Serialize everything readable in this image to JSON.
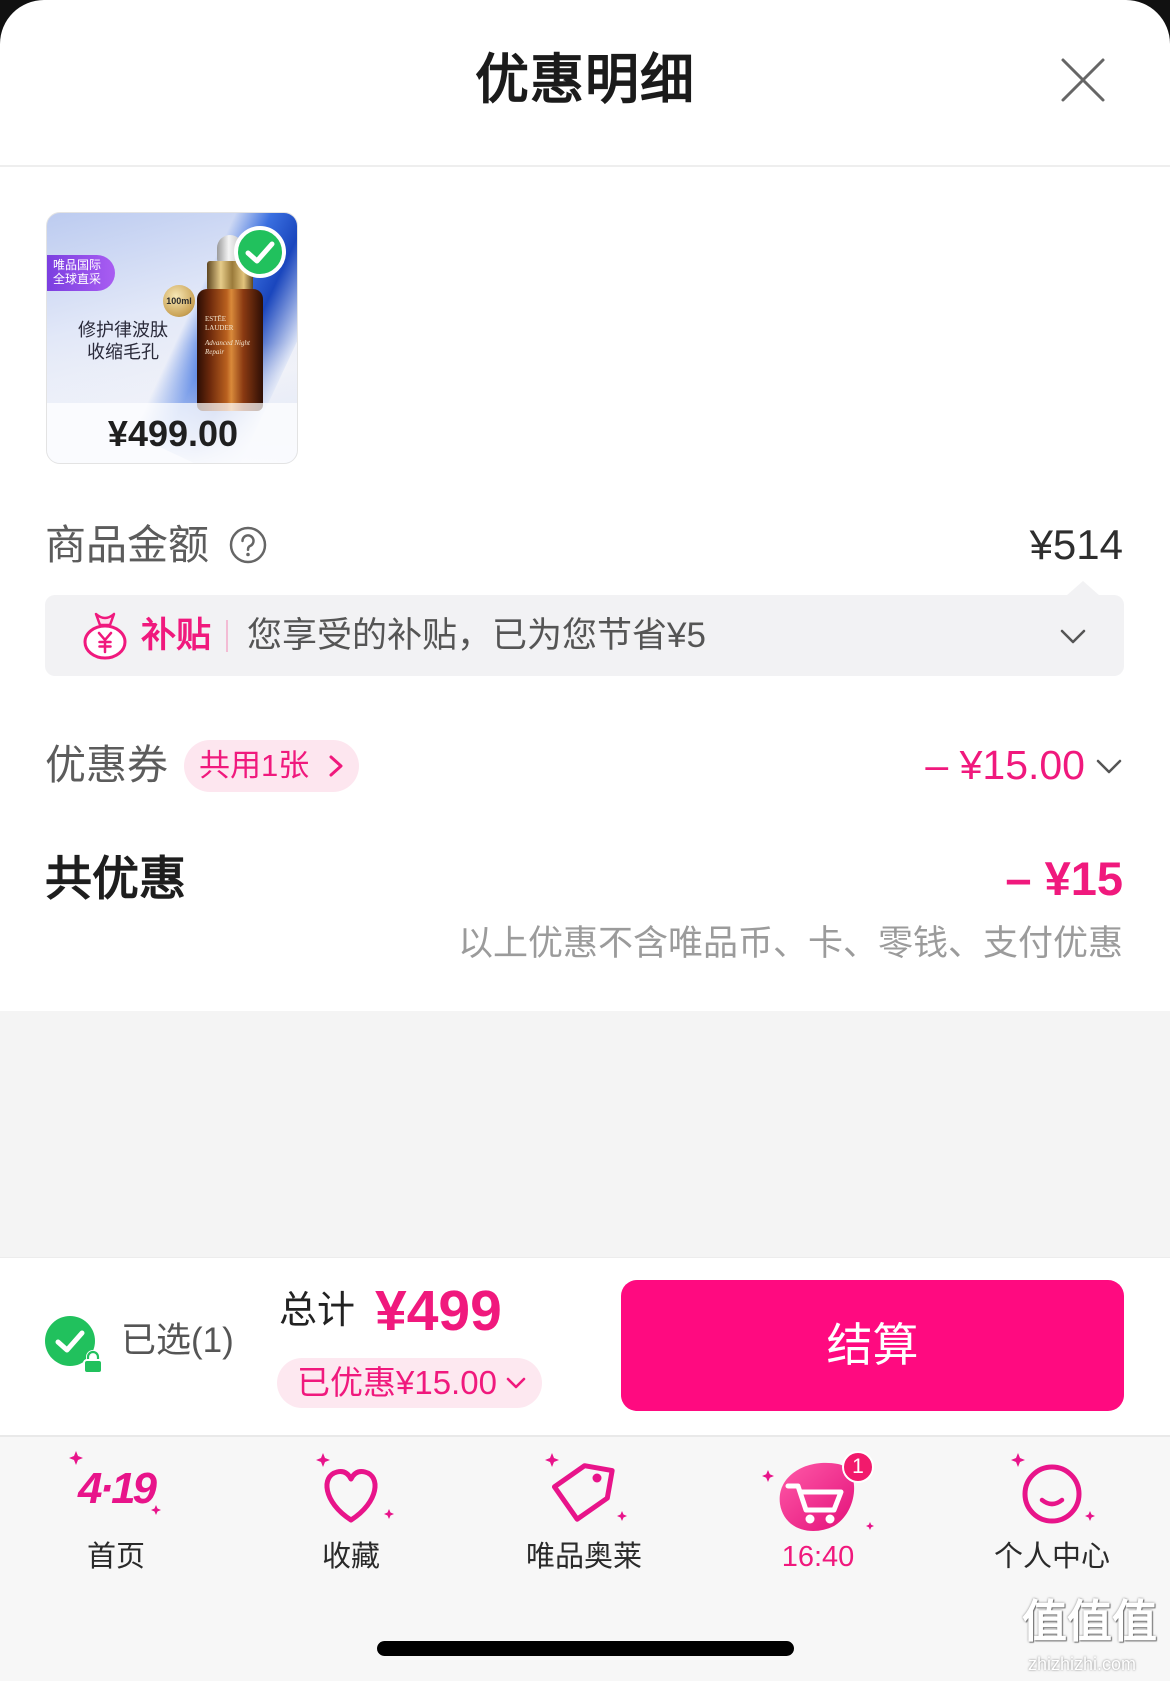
{
  "header": {
    "title": "优惠明细"
  },
  "product": {
    "badge_line1": "唯品国际",
    "badge_line2": "全球直采",
    "volume": "100ml",
    "slogan_line1": "修护律波肽",
    "slogan_line2": "收缩毛孔",
    "brand": "ESTĒE LAUDER",
    "product_name": "Advanced Night Repair",
    "price": "¥499.00"
  },
  "summary": {
    "goods_amount_label": "商品金额",
    "goods_amount_value": "¥514",
    "subsidy": {
      "tag": "补贴",
      "text": "您享受的补贴，已为您节省¥5"
    },
    "coupon": {
      "label": "优惠券",
      "badge": "共用1张",
      "value": "– ¥15.00"
    },
    "total_discount": {
      "label": "共优惠",
      "value": "– ¥15"
    },
    "note": "以上优惠不含唯品币、卡、零钱、支付优惠"
  },
  "checkout": {
    "selected_text": "已选(1)",
    "total_label": "总计",
    "total_value": "¥499",
    "discount_pill": "已优惠¥15.00",
    "submit": "结算"
  },
  "tabbar": [
    {
      "label": "首页",
      "icon": "home-419-icon",
      "icon_text": "4·19"
    },
    {
      "label": "收藏",
      "icon": "heart-icon"
    },
    {
      "label": "唯品奥莱",
      "icon": "tag-icon"
    },
    {
      "label": "16:40",
      "icon": "cart-icon",
      "badge": "1"
    },
    {
      "label": "个人中心",
      "icon": "smiley-icon"
    }
  ],
  "watermark": {
    "logo": "值值值",
    "site": "zhizhizhi.com"
  },
  "colors": {
    "accent": "#f0197d",
    "button": "#ff0a80",
    "success": "#21c15d",
    "subsidy_bg": "#f2f2f4",
    "page_gray": "#f4f4f4"
  }
}
